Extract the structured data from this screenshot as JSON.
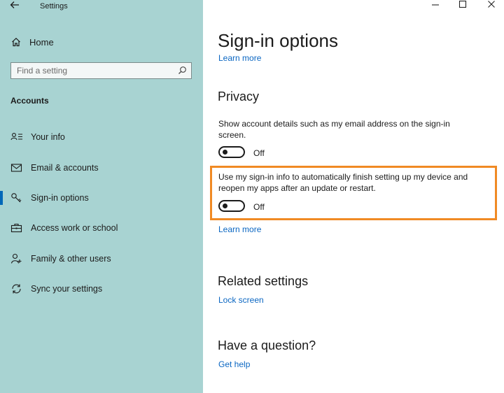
{
  "window": {
    "title": "Settings",
    "back_icon": "arrow-left-icon",
    "controls": [
      "minimize",
      "maximize",
      "close"
    ]
  },
  "sidebar": {
    "home_label": "Home",
    "search_placeholder": "Find a setting",
    "section_label": "Accounts",
    "items": [
      {
        "label": "Your info",
        "icon": "person-card-icon",
        "selected": false
      },
      {
        "label": "Email & accounts",
        "icon": "mail-icon",
        "selected": false
      },
      {
        "label": "Sign-in options",
        "icon": "key-icon",
        "selected": true
      },
      {
        "label": "Access work or school",
        "icon": "briefcase-icon",
        "selected": false
      },
      {
        "label": "Family & other users",
        "icon": "person-add-icon",
        "selected": false
      },
      {
        "label": "Sync your settings",
        "icon": "sync-icon",
        "selected": false
      }
    ],
    "accent_color": "#0067b8",
    "background_color": "#a8d3d2"
  },
  "main": {
    "title": "Sign-in options",
    "top_learn_more": "Learn more",
    "privacy": {
      "heading": "Privacy",
      "setting1": {
        "description": "Show account details such as my email address on the sign-in screen.",
        "state": "Off"
      },
      "setting2": {
        "description": "Use my sign-in info to automatically finish setting up my device and reopen my apps after an update or restart.",
        "state": "Off",
        "highlight_color": "#f08a24"
      },
      "learn_more": "Learn more"
    },
    "related": {
      "heading": "Related settings",
      "link": "Lock screen"
    },
    "question": {
      "heading": "Have a question?",
      "link": "Get help"
    },
    "link_color": "#0a66c2"
  }
}
